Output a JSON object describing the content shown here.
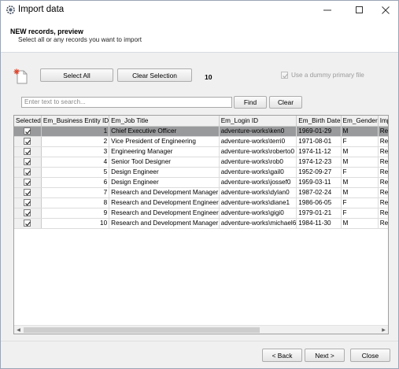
{
  "window": {
    "title": "Import data"
  },
  "header": {
    "title": "NEW records, preview",
    "subtitle": "Select all or any records you want to import"
  },
  "toolbar": {
    "select_all": "Select All",
    "clear_selection": "Clear Selection",
    "count": "10",
    "dummy_key_label": "Use a dummy primary file"
  },
  "search": {
    "placeholder": "Enter text to search...",
    "find": "Find",
    "clear": "Clear"
  },
  "grid": {
    "columns": [
      "Selected",
      "Em_Business Entity ID",
      "Em_Job Title",
      "Em_Login ID",
      "Em_Birth Date",
      "Em_Gender",
      "Imp"
    ],
    "rows": [
      [
        "1",
        "Chief Executive Officer",
        "adventure-works\\ken0",
        "1969-01-29",
        "M",
        "Rea"
      ],
      [
        "2",
        "Vice President of Engineering",
        "adventure-works\\terri0",
        "1971-08-01",
        "F",
        "Rea"
      ],
      [
        "3",
        "Engineering Manager",
        "adventure-works\\roberto0",
        "1974-11-12",
        "M",
        "Rea"
      ],
      [
        "4",
        "Senior Tool Designer",
        "adventure-works\\rob0",
        "1974-12-23",
        "M",
        "Rea"
      ],
      [
        "5",
        "Design Engineer",
        "adventure-works\\gail0",
        "1952-09-27",
        "F",
        "Rea"
      ],
      [
        "6",
        "Design Engineer",
        "adventure-works\\jossef0",
        "1959-03-11",
        "M",
        "Rea"
      ],
      [
        "7",
        "Research and Development Manager",
        "adventure-works\\dylan0",
        "1987-02-24",
        "M",
        "Rea"
      ],
      [
        "8",
        "Research and Development Engineer",
        "adventure-works\\diane1",
        "1986-06-05",
        "F",
        "Rea"
      ],
      [
        "9",
        "Research and Development Engineer",
        "adventure-works\\gigi0",
        "1979-01-21",
        "F",
        "Rea"
      ],
      [
        "10",
        "Research and Development Manager",
        "adventure-works\\michael6",
        "1984-11-30",
        "M",
        "Rea"
      ]
    ]
  },
  "footer": {
    "back": "< Back",
    "next": "Next >",
    "close": "Close"
  }
}
